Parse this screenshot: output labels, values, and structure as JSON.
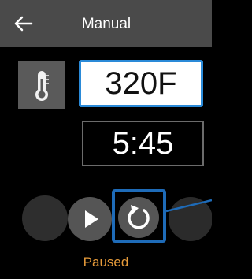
{
  "header": {
    "title": "Manual",
    "back_icon": "arrow-left-icon"
  },
  "controls": {
    "temperature": "320F",
    "time": "5:45",
    "thermometer_icon": "thermometer-icon"
  },
  "buttons": {
    "play_icon": "play-icon",
    "restart_icon": "restart-icon"
  },
  "status": {
    "text": "Paused"
  },
  "colors": {
    "accent_blue": "#2a8ad8",
    "highlight_blue": "#1e6bb8",
    "status_orange": "#e59a3a",
    "header_gray": "#4a4a4a"
  }
}
